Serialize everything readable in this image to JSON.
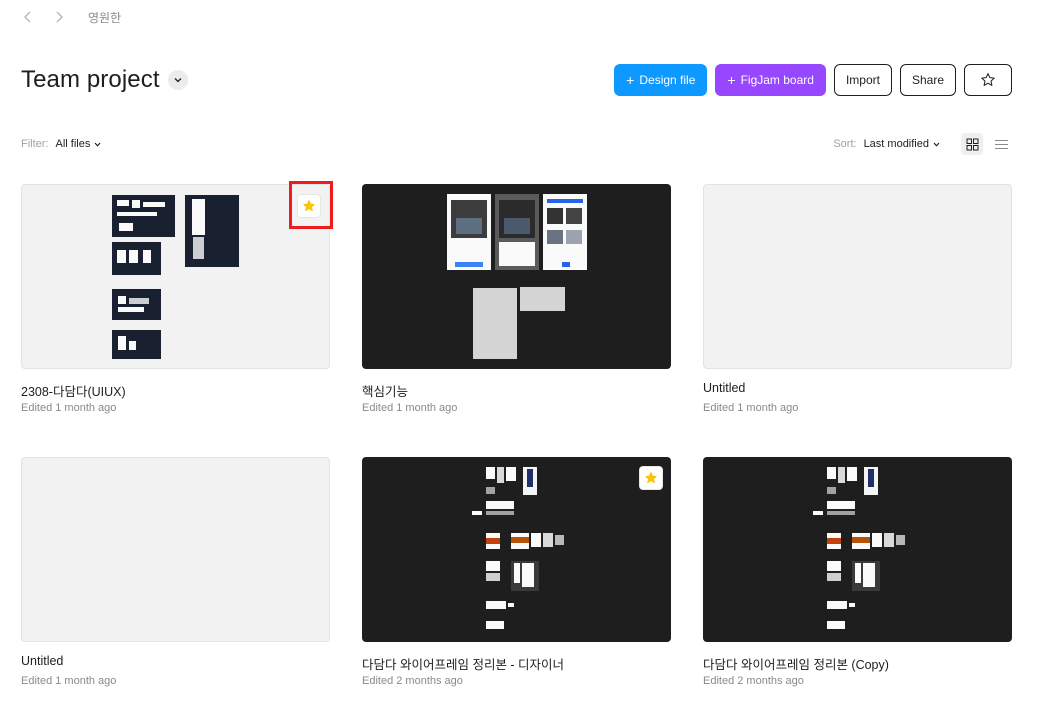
{
  "nav": {
    "back_icon": "chevron-left-icon",
    "forward_icon": "chevron-right-icon",
    "breadcrumb": "영원한"
  },
  "header": {
    "title": "Team project",
    "design_file_label": "Design file",
    "figjam_label": "FigJam board",
    "import_label": "Import",
    "share_label": "Share",
    "favorite_icon": "star-icon"
  },
  "filter": {
    "label": "Filter:",
    "value": "All files"
  },
  "sort": {
    "label": "Sort:",
    "value": "Last modified",
    "view_grid_icon": "grid-view-icon",
    "view_list_icon": "list-view-icon",
    "active_view": "grid"
  },
  "files": [
    {
      "name": "2308-다담다(UIUX)",
      "edited": "Edited 1 month ago",
      "favorite": true,
      "theme": "light"
    },
    {
      "name": "핵심기능",
      "edited": "Edited 1 month ago",
      "favorite": false,
      "theme": "dark"
    },
    {
      "name": "Untitled",
      "edited": "Edited 1 month ago",
      "favorite": false,
      "theme": "light"
    },
    {
      "name": "Untitled",
      "edited": "Edited 1 month ago",
      "favorite": false,
      "theme": "light"
    },
    {
      "name": "다담다 와이어프레임 정리본 - 디자이너",
      "edited": "Edited 2 months ago",
      "favorite": true,
      "theme": "dark"
    },
    {
      "name": "다담다 와이어프레임 정리본 (Copy)",
      "edited": "Edited 2 months ago",
      "favorite": false,
      "theme": "dark"
    }
  ],
  "colors": {
    "primary": "#0d99ff",
    "figjam": "#9747ff",
    "favorite_star": "#ffc700",
    "highlight": "#ee1c1c"
  }
}
